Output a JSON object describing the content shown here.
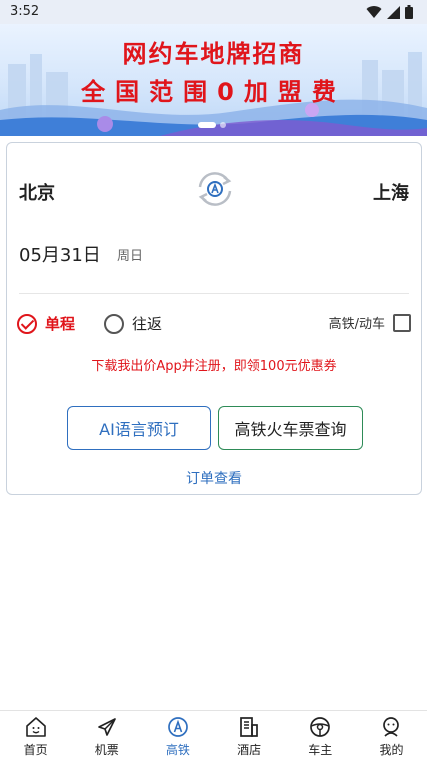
{
  "status_bar": {
    "time": "3:52"
  },
  "banner": {
    "line1": "网约车地牌招商",
    "line2": "全国范围0加盟费"
  },
  "booking": {
    "from_city": "北京",
    "to_city": "上海",
    "date": "05月31日",
    "weekday": "周日",
    "trip_single": "单程",
    "trip_round": "往返",
    "high_speed_label": "高铁/动车",
    "high_speed_checked": false,
    "promo": "下载我出价App并注册，即领100元优惠券",
    "ai_button": "AI语言预订",
    "train_button": "高铁火车票查询",
    "orders_link": "订单查看"
  },
  "nav": {
    "items": [
      {
        "label": "首页",
        "icon": "home-icon"
      },
      {
        "label": "机票",
        "icon": "plane-icon"
      },
      {
        "label": "高铁",
        "icon": "train-icon"
      },
      {
        "label": "酒店",
        "icon": "hotel-icon"
      },
      {
        "label": "车主",
        "icon": "steering-wheel-icon"
      },
      {
        "label": "我的",
        "icon": "profile-icon"
      }
    ],
    "active": "高铁"
  },
  "colors": {
    "accent_red": "#e0151b",
    "accent_blue": "#2f6fbf",
    "accent_green": "#2e8b57"
  }
}
